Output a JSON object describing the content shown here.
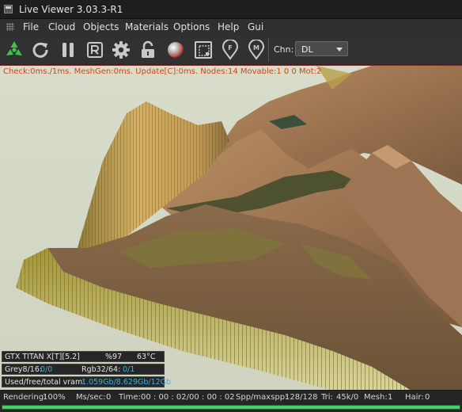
{
  "window": {
    "title": "Live Viewer 3.03.3-R1"
  },
  "menu": [
    "File",
    "Cloud",
    "Objects",
    "Materials",
    "Options",
    "Help",
    "Gui"
  ],
  "toolbar": {
    "buttons": [
      "radiation-icon",
      "reload-icon",
      "pause-icon",
      "r-button-icon",
      "gear-icon",
      "lock-icon",
      "sphere-icon",
      "region-icon",
      "focus-pin-icon",
      "material-pin-icon"
    ],
    "channel_label": "Chn:",
    "channel_value": "DL"
  },
  "viewport": {
    "stats_line": "Check:0ms./1ms. MeshGen:0ms. Update[C]:0ms. Nodes:14 Movable:1 0 0 Mot:2"
  },
  "gpu": {
    "name": "GTX TITAN X[T][5.2]",
    "usage": "%97",
    "temp": "63°C",
    "grey_label": "Grey8/16:",
    "grey_value": "0/0",
    "rgb_label": "Rgb32/64:",
    "rgb_value": "0/1",
    "vram_label": "Used/free/total vram:",
    "vram_value": "1.059Gb/8.629Gb/12Gb"
  },
  "status": {
    "rendering_label": "Rendering:",
    "rendering_value": "100%",
    "ms_label": "Ms/sec:",
    "ms_value": "0",
    "time_label": "Time:",
    "time_value": "00 : 00 : 02/00 : 00 : 02",
    "spp_label": "Spp/maxspp:",
    "spp_value": "128/128",
    "tri_label": "Tri:",
    "tri_value": "45k/0",
    "mesh_label": "Mesh:",
    "mesh_value": "1",
    "hair_label": "Hair:",
    "hair_value": "0",
    "progress_fraction": 1.0
  },
  "colors": {
    "accent_green": "#3fd26a",
    "stats_orange": "#c8471c",
    "value_cyan": "#3fb0d6"
  }
}
